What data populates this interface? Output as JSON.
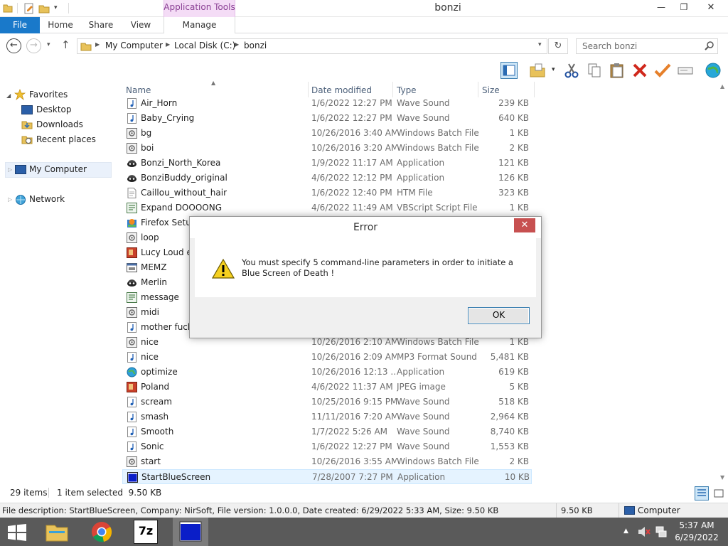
{
  "window": {
    "title": "bonzi",
    "contextual_tab_group": "Application Tools",
    "controls": {
      "minimize": "—",
      "maximize": "❐",
      "close": "✕"
    }
  },
  "ribbon": {
    "tabs": [
      "File",
      "Home",
      "Share",
      "View",
      "Manage"
    ]
  },
  "address": {
    "crumbs": [
      "My Computer",
      "Local Disk (C:)",
      "bonzi"
    ],
    "search_placeholder": "Search bonzi"
  },
  "nav": {
    "favorites": "Favorites",
    "desktop": "Desktop",
    "downloads": "Downloads",
    "recent": "Recent places",
    "computer": "My Computer",
    "network": "Network"
  },
  "columns": {
    "name": "Name",
    "date": "Date modified",
    "type": "Type",
    "size": "Size"
  },
  "files": [
    {
      "name": "Air_Horn",
      "date": "1/6/2022 12:27 PM",
      "type": "Wave Sound",
      "size": "239 KB",
      "icon": "audio-file-icon"
    },
    {
      "name": "Baby_Crying",
      "date": "1/6/2022 12:27 PM",
      "type": "Wave Sound",
      "size": "640 KB",
      "icon": "audio-file-icon"
    },
    {
      "name": "bg",
      "date": "10/26/2016 3:40 AM",
      "type": "Windows Batch File",
      "size": "1 KB",
      "icon": "batch-file-icon"
    },
    {
      "name": "boi",
      "date": "10/26/2016 3:20 AM",
      "type": "Windows Batch File",
      "size": "2 KB",
      "icon": "batch-file-icon"
    },
    {
      "name": "Bonzi_North_Korea",
      "date": "1/9/2022 11:17 AM",
      "type": "Application",
      "size": "121 KB",
      "icon": "agent-app-icon"
    },
    {
      "name": "BonziBuddy_original",
      "date": "4/6/2022 12:12 PM",
      "type": "Application",
      "size": "126 KB",
      "icon": "agent-app-icon"
    },
    {
      "name": "Caillou_without_hair",
      "date": "1/6/2022 12:40 PM",
      "type": "HTM File",
      "size": "323 KB",
      "icon": "document-file-icon"
    },
    {
      "name": "Expand DOOOONG",
      "date": "4/6/2022 11:49 AM",
      "type": "VBScript Script File",
      "size": "1 KB",
      "icon": "script-file-icon"
    },
    {
      "name": "Firefox Setup",
      "date": "",
      "type": "",
      "size": "",
      "icon": "installer-icon"
    },
    {
      "name": "loop",
      "date": "",
      "type": "",
      "size": "",
      "icon": "batch-file-icon"
    },
    {
      "name": "Lucy Loud ey",
      "date": "",
      "type": "",
      "size": "",
      "icon": "image-file-icon"
    },
    {
      "name": "MEMZ",
      "date": "",
      "type": "",
      "size": "",
      "icon": "app-window-icon"
    },
    {
      "name": "Merlin",
      "date": "",
      "type": "",
      "size": "",
      "icon": "agent-app-icon"
    },
    {
      "name": "message",
      "date": "",
      "type": "",
      "size": "",
      "icon": "script-file-icon"
    },
    {
      "name": "midi",
      "date": "",
      "type": "",
      "size": "",
      "icon": "batch-file-icon"
    },
    {
      "name": "mother fucke",
      "date": "",
      "type": "",
      "size": "",
      "icon": "audio-file-icon"
    },
    {
      "name": "nice",
      "date": "10/26/2016 2:10 AM",
      "type": "Windows Batch File",
      "size": "1 KB",
      "icon": "batch-file-icon"
    },
    {
      "name": "nice",
      "date": "10/26/2016 2:09 AM",
      "type": "MP3 Format Sound",
      "size": "5,481 KB",
      "icon": "audio-file-icon"
    },
    {
      "name": "optimize",
      "date": "10/26/2016 12:13 ...",
      "type": "Application",
      "size": "619 KB",
      "icon": "globe-app-icon"
    },
    {
      "name": "Poland",
      "date": "4/6/2022 11:37 AM",
      "type": "JPEG image",
      "size": "5 KB",
      "icon": "image-file-icon"
    },
    {
      "name": "scream",
      "date": "10/25/2016 9:15 PM",
      "type": "Wave Sound",
      "size": "518 KB",
      "icon": "audio-file-icon"
    },
    {
      "name": "smash",
      "date": "11/11/2016 7:20 AM",
      "type": "Wave Sound",
      "size": "2,964 KB",
      "icon": "audio-file-icon"
    },
    {
      "name": "Smooth",
      "date": "1/7/2022 5:26 AM",
      "type": "Wave Sound",
      "size": "8,740 KB",
      "icon": "audio-file-icon"
    },
    {
      "name": "Sonic",
      "date": "1/6/2022 12:27 PM",
      "type": "Wave Sound",
      "size": "1,553 KB",
      "icon": "audio-file-icon"
    },
    {
      "name": "start",
      "date": "10/26/2016 3:55 AM",
      "type": "Windows Batch File",
      "size": "2 KB",
      "icon": "batch-file-icon"
    },
    {
      "name": "StartBlueScreen",
      "date": "7/28/2007 7:27 PM",
      "type": "Application",
      "size": "10 KB",
      "icon": "blue-screen-app-icon",
      "selected": true
    }
  ],
  "status": {
    "item_count": "29 items",
    "selection": "1 item selected  9.50 KB"
  },
  "details": {
    "description": "File description: StartBlueScreen, Company: NirSoft, File version: 1.0.0.0, Date created: 6/29/2022 5:33 AM, Size: 9.50 KB",
    "size": "9.50 KB",
    "location": "Computer"
  },
  "dialog": {
    "title": "Error",
    "close": "✕",
    "message": "You must specify 5 command-line parameters in order to initiate a Blue Screen of Death !",
    "ok_label": "OK"
  },
  "taskbar": {
    "time": "5:37 AM",
    "date": "6/29/2022",
    "seven_zip_label": "7z"
  },
  "colors": {
    "file_tab": "#1979ca",
    "contextual_tab": "#f4dcf6",
    "selection": "#cce8ff",
    "taskbar": "#5a5a5a",
    "dialog_close": "#c75050"
  }
}
